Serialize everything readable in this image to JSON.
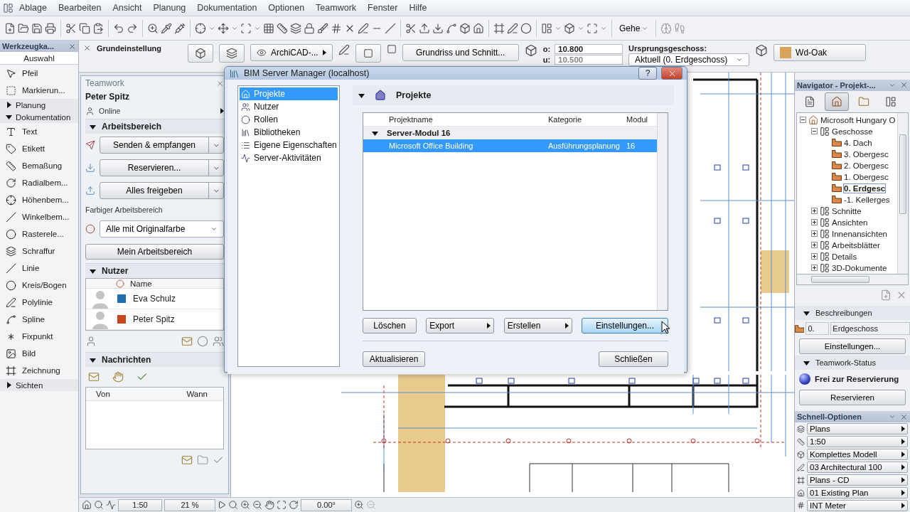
{
  "menu": [
    "Ablage",
    "Bearbeiten",
    "Ansicht",
    "Planung",
    "Dokumentation",
    "Optionen",
    "Teamwork",
    "Fenster",
    "Hilfe"
  ],
  "toolbar": {
    "goto": "Gehe"
  },
  "infobox": {
    "title": "Grundeinstellung",
    "layer": "ArchiCAD-...",
    "section_button": "Grundriss und Schnitt...",
    "top_label": "o:",
    "top_value": "10.800",
    "bottom_label": "u:",
    "bottom_value": "10.500",
    "story_label": "Ursprungsgeschoss:",
    "story_value": "Aktuell (0. Erdgeschoss)",
    "material": "Wd-Oak"
  },
  "toolbox": {
    "title": "Werkzeugka...",
    "selection": "Auswahl",
    "items": [
      {
        "kind": "tool",
        "label": "Pfeil"
      },
      {
        "kind": "tool",
        "label": "Markierun..."
      },
      {
        "kind": "group",
        "label": "Planung",
        "expanded": false
      },
      {
        "kind": "group",
        "label": "Dokumentation",
        "expanded": true
      },
      {
        "kind": "tool",
        "label": "Text"
      },
      {
        "kind": "tool",
        "label": "Etikett"
      },
      {
        "kind": "tool",
        "label": "Bemaßung"
      },
      {
        "kind": "tool",
        "label": "Radialbem..."
      },
      {
        "kind": "tool",
        "label": "Höhenbem..."
      },
      {
        "kind": "tool",
        "label": "Winkelbem..."
      },
      {
        "kind": "tool",
        "label": "Rasterele..."
      },
      {
        "kind": "tool",
        "label": "Schraffur"
      },
      {
        "kind": "tool",
        "label": "Linie"
      },
      {
        "kind": "tool",
        "label": "Kreis/Bogen"
      },
      {
        "kind": "tool",
        "label": "Polylinie"
      },
      {
        "kind": "tool",
        "label": "Spline"
      },
      {
        "kind": "tool",
        "label": "Fixpunkt"
      },
      {
        "kind": "tool",
        "label": "Bild"
      },
      {
        "kind": "tool",
        "label": "Zeichnung"
      },
      {
        "kind": "group",
        "label": "Sichten",
        "expanded": false
      }
    ]
  },
  "teamwork": {
    "title": "Teamwork",
    "user": "Peter Spitz",
    "status": "Online",
    "workspace_heading": "Arbeitsbereich",
    "workspace_buttons": [
      "Senden & empfangen",
      "Reservieren...",
      "Alles freigeben"
    ],
    "color_label": "Farbiger Arbeitsbereich",
    "color_value": "Alle mit Originalfarbe",
    "my_workspace": "Mein Arbeitsbereich",
    "users": {
      "heading": "Nutzer",
      "column": "Name",
      "rows": [
        {
          "name": "Eva Schulz",
          "color": "#1f6fae"
        },
        {
          "name": "Peter Spitz",
          "color": "#c8461e"
        }
      ]
    },
    "messages": {
      "heading": "Nachrichten",
      "columns": [
        "Von",
        "Wann"
      ]
    }
  },
  "dialog": {
    "title": "BIM Server Manager (localhost)",
    "help": "?",
    "nav": [
      {
        "label": "Projekte",
        "selected": true
      },
      {
        "label": "Nutzer",
        "selected": false
      },
      {
        "label": "Rollen",
        "selected": false
      },
      {
        "label": "Bibliotheken",
        "selected": false
      },
      {
        "label": "Eigene Eigenschaften",
        "selected": false
      },
      {
        "label": "Server-Aktivitäten",
        "selected": false
      }
    ],
    "section": "Projekte",
    "columns": [
      "Projektname",
      "Kategorie",
      "Modul"
    ],
    "groups": [
      {
        "name": "Server-Modul 16",
        "expanded": true,
        "rows": [
          {
            "name": "Microsoft Office Building",
            "category": "Ausführungsplanung",
            "module": "16",
            "selected": true
          }
        ]
      }
    ],
    "actions": [
      {
        "label": "Löschen",
        "menu": false,
        "default": false
      },
      {
        "label": "Export",
        "menu": true,
        "default": false
      },
      {
        "label": "Erstellen",
        "menu": true,
        "default": false
      },
      {
        "label": "Einstellungen...",
        "menu": false,
        "default": true
      }
    ],
    "refresh": "Aktualisieren",
    "close": "Schließen"
  },
  "navigator": {
    "title": "Navigator - Projekt-...",
    "tabs": [
      {
        "selected": false
      },
      {
        "selected": true
      },
      {
        "selected": false
      },
      {
        "selected": false
      }
    ],
    "tree": [
      {
        "label": "Microsoft Hungary O",
        "expanded": true,
        "selected": false,
        "children": [
          {
            "label": "Geschosse",
            "expanded": true,
            "selected": false,
            "children": [
              {
                "label": "4. Dach",
                "selected": false
              },
              {
                "label": "3. Obergesc",
                "selected": false
              },
              {
                "label": "2. Obergesc",
                "selected": false
              },
              {
                "label": "1. Obergesc",
                "selected": false
              },
              {
                "label": "0. Erdgesc",
                "selected": true
              },
              {
                "label": "-1. Kellerges",
                "selected": false
              }
            ]
          },
          {
            "label": "Schnitte",
            "expanded": false,
            "selected": false
          },
          {
            "label": "Ansichten",
            "expanded": false,
            "selected": false
          },
          {
            "label": "Innenansichten",
            "expanded": false,
            "selected": false
          },
          {
            "label": "Arbeitsblätter",
            "expanded": false,
            "selected": false
          },
          {
            "label": "Details",
            "expanded": false,
            "selected": false
          },
          {
            "label": "3D-Dokumente",
            "expanded": false,
            "selected": false
          }
        ]
      }
    ],
    "description_heading": "Beschreibungen",
    "story_number": "0.",
    "story_name": "Erdgeschoss",
    "settings": "Einstellungen...",
    "status_heading": "Teamwork-Status",
    "status_text": "Frei zur Reservierung",
    "reserve": "Reservieren"
  },
  "quick_options": {
    "title": "Schnell-Optionen",
    "items": [
      "Plans",
      "1:50",
      "Komplettes Modell",
      "03 Architectural 100",
      "Plans - CD",
      "01 Existing Plan",
      "INT Meter"
    ]
  },
  "statusbar": {
    "scale": "1:50",
    "zoom": "21 %",
    "angle": "0.00°"
  }
}
